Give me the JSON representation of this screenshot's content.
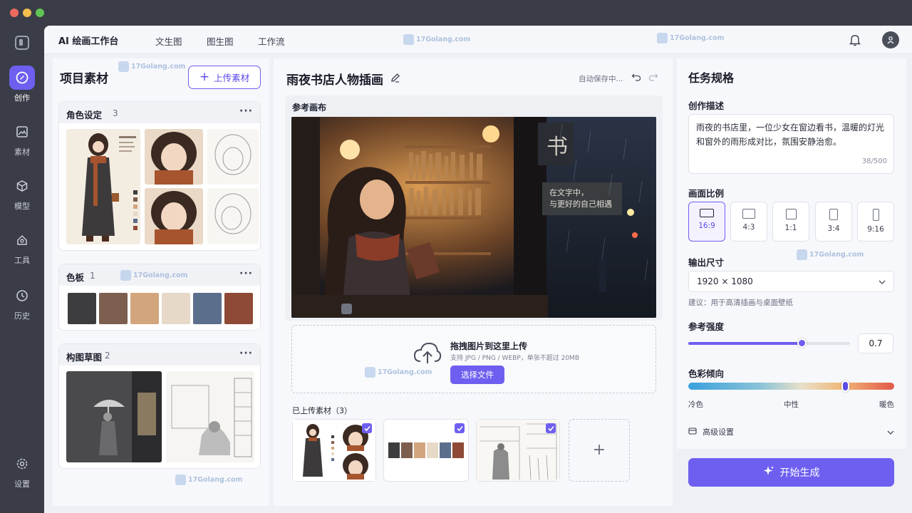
{
  "window": {
    "dots": [
      "#ee6a5e",
      "#f5bf4f",
      "#61c554"
    ]
  },
  "rail": {
    "items": [
      {
        "label": "创作",
        "icon": "create-icon",
        "active": true
      },
      {
        "label": "素材",
        "icon": "image-icon"
      },
      {
        "label": "模型",
        "icon": "cube-icon"
      },
      {
        "label": "工具",
        "icon": "tools-icon"
      },
      {
        "label": "历史",
        "icon": "clock-icon"
      }
    ],
    "settings": "设置"
  },
  "topnav": {
    "brand": "AI 绘画工作台",
    "tabs": [
      "文生图",
      "图生图",
      "工作流"
    ],
    "watermark": "17Golang.com"
  },
  "left": {
    "title": "项目素材",
    "upload_button": "上传素材",
    "cards": [
      {
        "title": "角色设定",
        "count": "3"
      },
      {
        "title": "色板",
        "count": "1"
      },
      {
        "title": "构图草图",
        "count": "2"
      }
    ],
    "palette": [
      "#3d3d3f",
      "#7d5f50",
      "#d3a57d",
      "#e7d9c8",
      "#5b6e8c",
      "#8e4a36"
    ]
  },
  "mid": {
    "title": "雨夜书店人物插画",
    "autosave": "自动保存中...",
    "canvas_label": "参考画布",
    "sign_big": "书",
    "sign_small": "在文字中，与更好的自己相遇",
    "dropzone": {
      "title": "拖拽图片到这里上传",
      "hint": "支持 JPG / PNG / WEBP，单张不超过 20MB",
      "button": "选择文件"
    },
    "uploaded_label": "已上传素材（3）"
  },
  "right": {
    "title": "任务规格",
    "desc_label": "创作描述",
    "description": "雨夜的书店里，一位少女在窗边看书，温暖的灯光和窗外的雨形成对比，氛围安静治愈。",
    "desc_count": "38/500",
    "ratio_label": "画面比例",
    "ratios": [
      "16:9",
      "4:3",
      "1:1",
      "3:4",
      "9:16"
    ],
    "selected_ratio": "16:9",
    "output_label": "输出尺寸",
    "output_value": "1920 × 1080",
    "output_hint": "建议：用于高清插画与桌面壁纸",
    "strength_label": "参考强度",
    "strength": 0.7,
    "strength_text": "0.7",
    "color_label": "色彩倾向",
    "color_position": 0.76,
    "color_ticks": [
      "冷色",
      "中性",
      "暖色"
    ],
    "advanced": "高级设置",
    "generate": "开始生成"
  }
}
